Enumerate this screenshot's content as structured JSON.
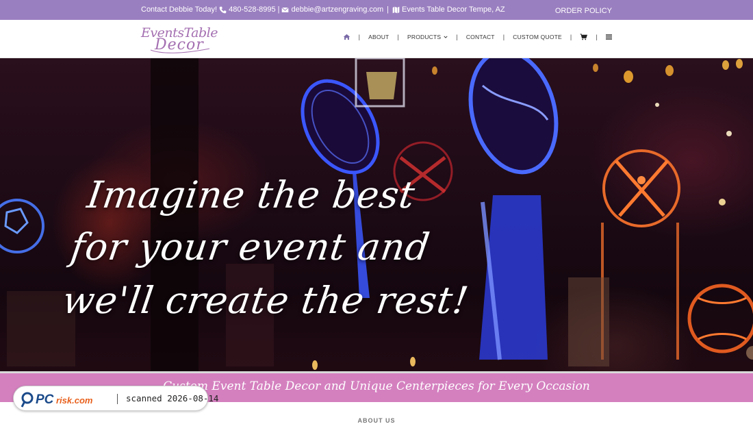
{
  "topbar": {
    "contact_text": "Contact Debbie Today!",
    "phone": "480-528-8995",
    "separator": "|",
    "email": "debbie@artzengraving.com",
    "separator2": "|",
    "location": "Events Table Decor Tempe, AZ",
    "order_policy": "ORDER POLICY",
    "icons": [
      "phone-icon",
      "envelope-icon",
      "map-icon"
    ]
  },
  "logo": {
    "line1": "EventsTable",
    "line2": "Decor"
  },
  "nav": {
    "items": [
      {
        "label": "ABOUT"
      },
      {
        "label": "PRODUCTS"
      },
      {
        "label": "CONTACT"
      },
      {
        "label": "CUSTOM QUOTE"
      }
    ],
    "separator": "|",
    "icons": [
      "home-icon",
      "chevron-down-icon",
      "cart-icon",
      "menu-icon"
    ]
  },
  "hero": {
    "line1": "Imagine the best",
    "line2": "for your event and",
    "line3": "we'll create the rest!"
  },
  "banner": {
    "text": "Custom Event Table Decor and Unique Centerpieces for Every Occasion"
  },
  "about": {
    "heading": "ABOUT US"
  },
  "watermark": {
    "brand": "PCrisk.com",
    "scan_text": "scanned 2026-08-14"
  },
  "colors": {
    "topbar": "#9a7fc0",
    "banner": "#d480bf",
    "logo": "#a46fb1",
    "nav_home": "#7a6aa8"
  }
}
